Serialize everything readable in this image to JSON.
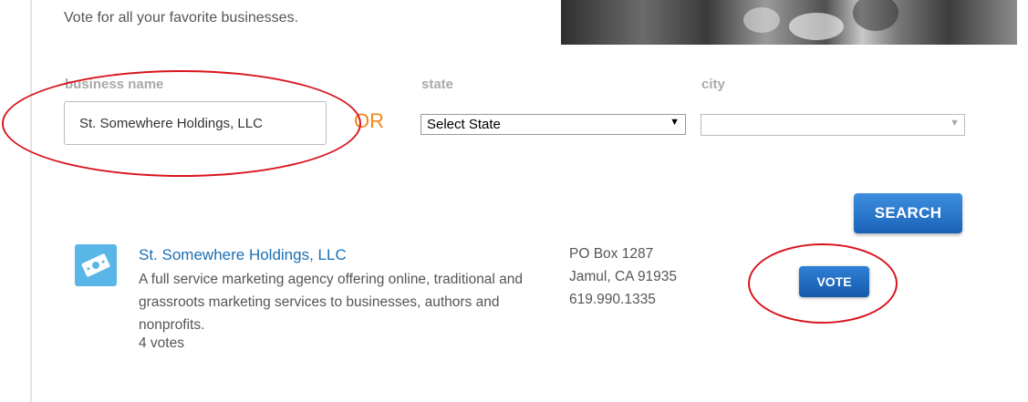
{
  "intro": {
    "text": "Vote for all your favorite businesses."
  },
  "search_form": {
    "business_name": {
      "label": "business name",
      "value": "St. Somewhere Holdings, LLC"
    },
    "or_text": "OR",
    "state": {
      "label": "state",
      "selected": "Select State"
    },
    "city": {
      "label": "city",
      "selected": ""
    },
    "search_label": "SEARCH"
  },
  "result": {
    "icon": "ticket-icon",
    "name": "St. Somewhere Holdings, LLC",
    "description": "A full service marketing agency offering online, traditional and grassroots marketing services to businesses, authors and nonprofits.",
    "votes": "4 votes",
    "address_line1": "PO Box 1287",
    "address_line2": "Jamul, CA 91935",
    "phone": "619.990.1335",
    "vote_label": "VOTE"
  },
  "colors": {
    "accent_blue": "#1a62b8",
    "link_blue": "#1a6fb5",
    "or_orange": "#f0871e",
    "annotation_red": "#d9141c",
    "icon_bg": "#5ab6e6"
  }
}
